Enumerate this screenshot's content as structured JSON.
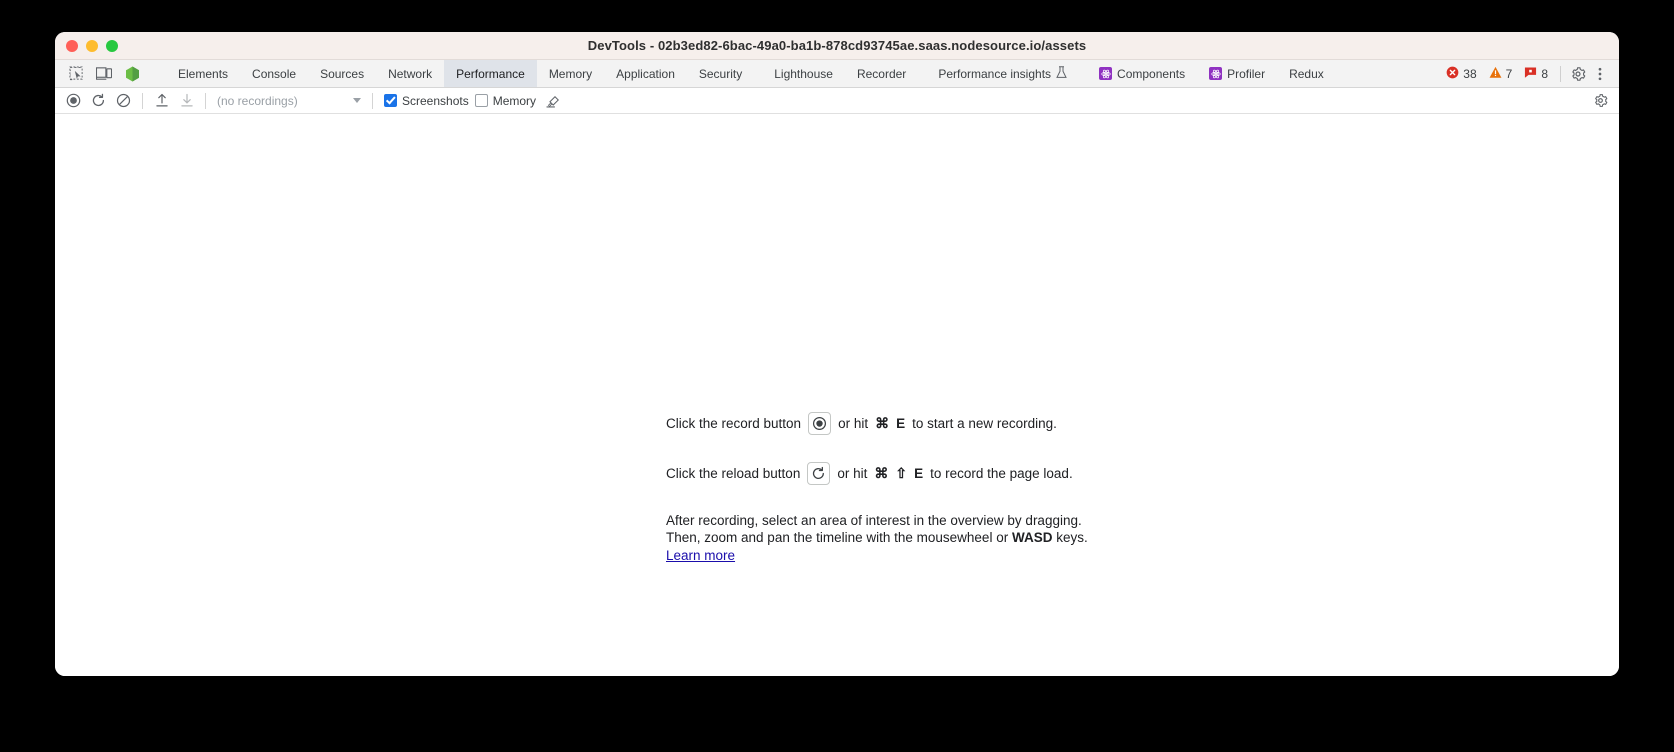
{
  "window": {
    "title": "DevTools - 02b3ed82-6bac-49a0-ba1b-878cd93745ae.saas.nodesource.io/assets",
    "traffic_lights": [
      "close",
      "minimize",
      "zoom"
    ]
  },
  "tabbar": {
    "left_icons": [
      {
        "name": "inspect-element-icon",
        "title": "Inspect element"
      },
      {
        "name": "device-toolbar-icon",
        "title": "Toggle device toolbar"
      },
      {
        "name": "nodejs-icon",
        "title": "Open dedicated DevTools for Node.js"
      }
    ],
    "tabs": [
      {
        "label": "Elements",
        "selected": false
      },
      {
        "label": "Console",
        "selected": false
      },
      {
        "label": "Sources",
        "selected": false
      },
      {
        "label": "Network",
        "selected": false
      },
      {
        "label": "Performance",
        "selected": true
      },
      {
        "label": "Memory",
        "selected": false
      },
      {
        "label": "Application",
        "selected": false
      },
      {
        "label": "Security",
        "selected": false
      },
      {
        "label": "Lighthouse",
        "selected": false
      },
      {
        "label": "Recorder",
        "selected": false
      },
      {
        "label": "Performance insights",
        "selected": false,
        "icon": "experiment-flask-icon"
      },
      {
        "label": "Components",
        "selected": false,
        "icon": "react-logo-icon"
      },
      {
        "label": "Profiler",
        "selected": false,
        "icon": "react-logo-icon"
      },
      {
        "label": "Redux",
        "selected": false
      }
    ],
    "badges": [
      {
        "name": "error-count",
        "icon": "error-circle-icon",
        "count": "38",
        "color": "#d93025"
      },
      {
        "name": "warning-count",
        "icon": "warning-triangle-icon",
        "count": "7",
        "color": "#e8710a"
      },
      {
        "name": "issue-count",
        "icon": "issue-square-icon",
        "count": "8",
        "color": "#d93025"
      }
    ],
    "settings_label": "Settings",
    "more_label": "Customize and control DevTools"
  },
  "perfbar": {
    "record_title": "Record",
    "reload_title": "Start profiling and reload page",
    "clear_title": "Clear",
    "load_title": "Load profile",
    "save_title": "Save profile",
    "recordings_value": "(no recordings)",
    "screenshots_label": "Screenshots",
    "screenshots_checked": true,
    "memory_label": "Memory",
    "memory_checked": false,
    "gc_title": "Collect garbage",
    "capture_settings_title": "Capture settings"
  },
  "landing": {
    "record_line_prefix": "Click the record button",
    "record_line_suffix_pre": "or hit",
    "record_shortcut_mod": "⌘",
    "record_shortcut_key": "E",
    "record_line_suffix_post": "to start a new recording.",
    "reload_line_prefix": "Click the reload button",
    "reload_line_suffix_pre": "or hit",
    "reload_shortcut_mod": "⌘",
    "reload_shortcut_shift": "⇧",
    "reload_shortcut_key": "E",
    "reload_line_suffix_post": "to record the page load.",
    "para_line1": "After recording, select an area of interest in the overview by dragging.",
    "para_line2_pre": "Then, zoom and pan the timeline with the mousewheel or",
    "para_line2_keys": "WASD",
    "para_line2_post": "keys.",
    "learn_more": "Learn more"
  },
  "colors": {
    "titlebar_bg": "#f6efec",
    "tabbar_bg": "#f3f3f3",
    "selected_tab_bg": "#dfe3e9",
    "accent_blue": "#1a73e8",
    "link_blue": "#1a0dab",
    "error_red": "#d93025",
    "warning_orange": "#e8710a",
    "react_purple": "#8f32c1",
    "node_green": "#62a73b"
  }
}
